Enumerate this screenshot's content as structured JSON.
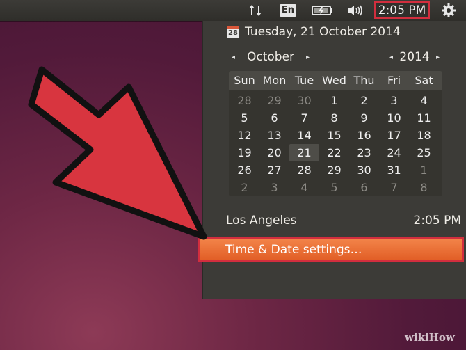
{
  "topbar": {
    "keyboard_label": "En",
    "clock_time": "2:05 PM",
    "icons": [
      "network-icon",
      "keyboard-icon",
      "battery-icon",
      "volume-icon",
      "gear-icon"
    ]
  },
  "calendar": {
    "date_line": "Tuesday, 21 October 2014",
    "month": "October",
    "year": "2014",
    "weekdays": [
      "Sun",
      "Mon",
      "Tue",
      "Wed",
      "Thu",
      "Fri",
      "Sat"
    ],
    "weeks": [
      [
        "28",
        "29",
        "30",
        "1",
        "2",
        "3",
        "4"
      ],
      [
        "5",
        "6",
        "7",
        "8",
        "9",
        "10",
        "11"
      ],
      [
        "12",
        "13",
        "14",
        "15",
        "16",
        "17",
        "18"
      ],
      [
        "19",
        "20",
        "21",
        "22",
        "23",
        "24",
        "25"
      ],
      [
        "26",
        "27",
        "28",
        "29",
        "30",
        "31",
        "1"
      ],
      [
        "2",
        "3",
        "4",
        "5",
        "6",
        "7",
        "8"
      ]
    ],
    "today": "21",
    "nav_prev": "◂",
    "nav_next": "▸"
  },
  "location": {
    "city": "Los Angeles",
    "time": "2:05 PM"
  },
  "menu": {
    "settings_label": "Time & Date settings…"
  },
  "colors": {
    "highlight_border": "#d22e3e",
    "menu_orange": "#e8692f",
    "arrow_red": "#d8353f"
  },
  "watermark": "wikiHow"
}
